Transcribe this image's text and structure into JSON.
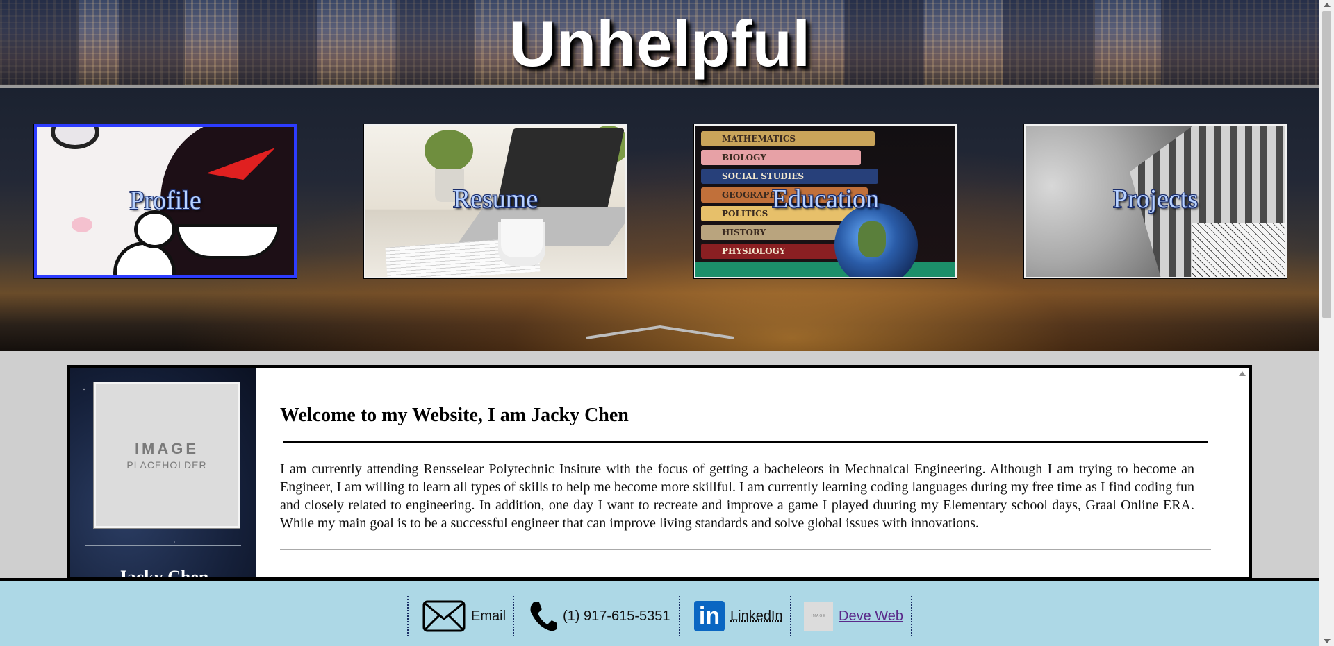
{
  "header": {
    "title": "Unhelpful"
  },
  "nav": {
    "tiles": [
      {
        "label": "Profile",
        "active": true
      },
      {
        "label": "Resume",
        "active": false
      },
      {
        "label": "Education",
        "active": false
      },
      {
        "label": "Projects",
        "active": false
      }
    ],
    "education_books": [
      "MATHEMATICS",
      "BIOLOGY",
      "SOCIAL STUDIES",
      "GEOGRAPHY",
      "POLITICS",
      "HISTORY",
      "PHYSIOLOGY"
    ]
  },
  "sidebar": {
    "avatar_line1": "IMAGE",
    "avatar_line2": "PLACEHOLDER",
    "name": "Jacky Chen"
  },
  "content": {
    "heading": "Welcome to my Website, I am Jacky Chen",
    "paragraph": "I am currently attending Rensselear Polytechnic Insitute with the focus of getting a bacheleors in Mechnaical Engineering. Although I am trying to become an Engineer, I am willing to learn all types of skills to help me become more skillful. I am currently learning coding languages during my free time as I find coding fun and closely related to engineering. In addition, one day I want to recreate and improve a game I played duuring my Elementary school days, Graal Online ERA. While my main goal is to be a successful engineer that can improve living standards and solve global issues with innovations."
  },
  "footer": {
    "email": {
      "label": "Email",
      "icon": "envelope-icon"
    },
    "phone": {
      "label": "(1) 917-615-5351",
      "icon": "phone-icon"
    },
    "linkedin": {
      "label": "LinkedIn",
      "icon": "linkedin-icon",
      "logo_text": "in"
    },
    "deveweb": {
      "label": "Deve Web",
      "icon": "image-placeholder-icon",
      "thumb_text": "IMAGE"
    }
  },
  "colors": {
    "footer_bg": "#add8e6",
    "active_tile_border": "#2d3cff",
    "tile_label": "#b8d2ff",
    "link_visited": "#5a2a8a"
  }
}
